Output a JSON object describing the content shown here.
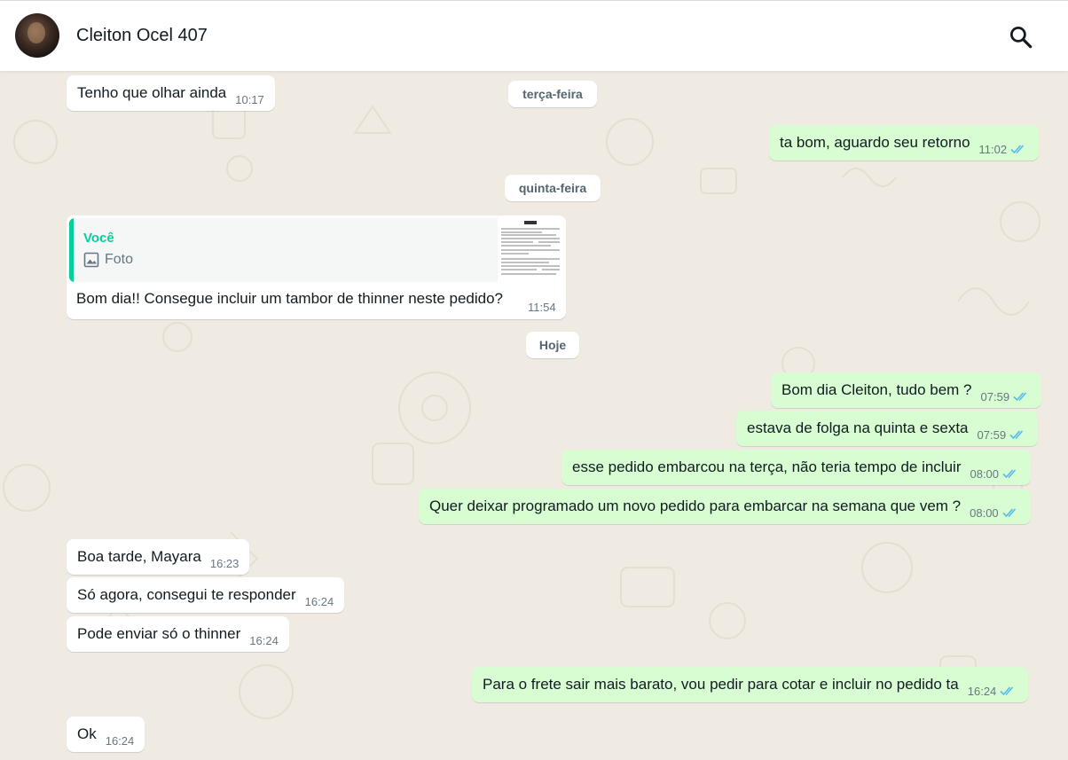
{
  "header": {
    "contact_name": "Cleiton Ocel 407",
    "avatar_icon": "contact-avatar",
    "search_icon": "search-icon"
  },
  "dates": {
    "tuesday": "terça-feira",
    "thursday": "quinta-feira",
    "today": "Hoje"
  },
  "messages": [
    {
      "direction": "in",
      "text": "Tenho que olhar ainda",
      "time": "10:17"
    },
    {
      "direction": "out",
      "text": "ta bom, aguardo seu retorno",
      "time": "11:02",
      "status": "read"
    },
    {
      "direction": "in",
      "text": "Bom dia!! Consegue incluir um tambor de thinner neste pedido?",
      "time": "11:54",
      "quote": {
        "author": "Você",
        "media_label": "Foto",
        "media_icon": "image-icon"
      }
    },
    {
      "direction": "out",
      "text": "Bom dia Cleiton, tudo bem ?",
      "time": "07:59",
      "status": "read"
    },
    {
      "direction": "out",
      "text": "estava de folga na quinta e sexta",
      "time": "07:59",
      "status": "read"
    },
    {
      "direction": "out",
      "text": "esse pedido embarcou na terça, não teria tempo de incluir",
      "time": "08:00",
      "status": "read"
    },
    {
      "direction": "out",
      "text": "Quer deixar programado um novo pedido para embarcar na semana que vem ?",
      "time": "08:00",
      "status": "read"
    },
    {
      "direction": "in",
      "text": "Boa tarde, Mayara",
      "time": "16:23"
    },
    {
      "direction": "in",
      "text": "Só agora, consegui te responder",
      "time": "16:24"
    },
    {
      "direction": "in",
      "text": "Pode enviar só o thinner",
      "time": "16:24"
    },
    {
      "direction": "out",
      "text": "Para o frete sair mais barato, vou pedir para cotar e incluir no pedido ta",
      "time": "16:24",
      "status": "read"
    },
    {
      "direction": "in",
      "text": "Ok",
      "time": "16:24"
    }
  ],
  "colors": {
    "incoming_bubble": "#ffffff",
    "outgoing_bubble": "#d9fdd3",
    "read_ticks": "#53bdeb",
    "quote_accent": "#06cf9c",
    "chat_background": "#efeae2"
  }
}
